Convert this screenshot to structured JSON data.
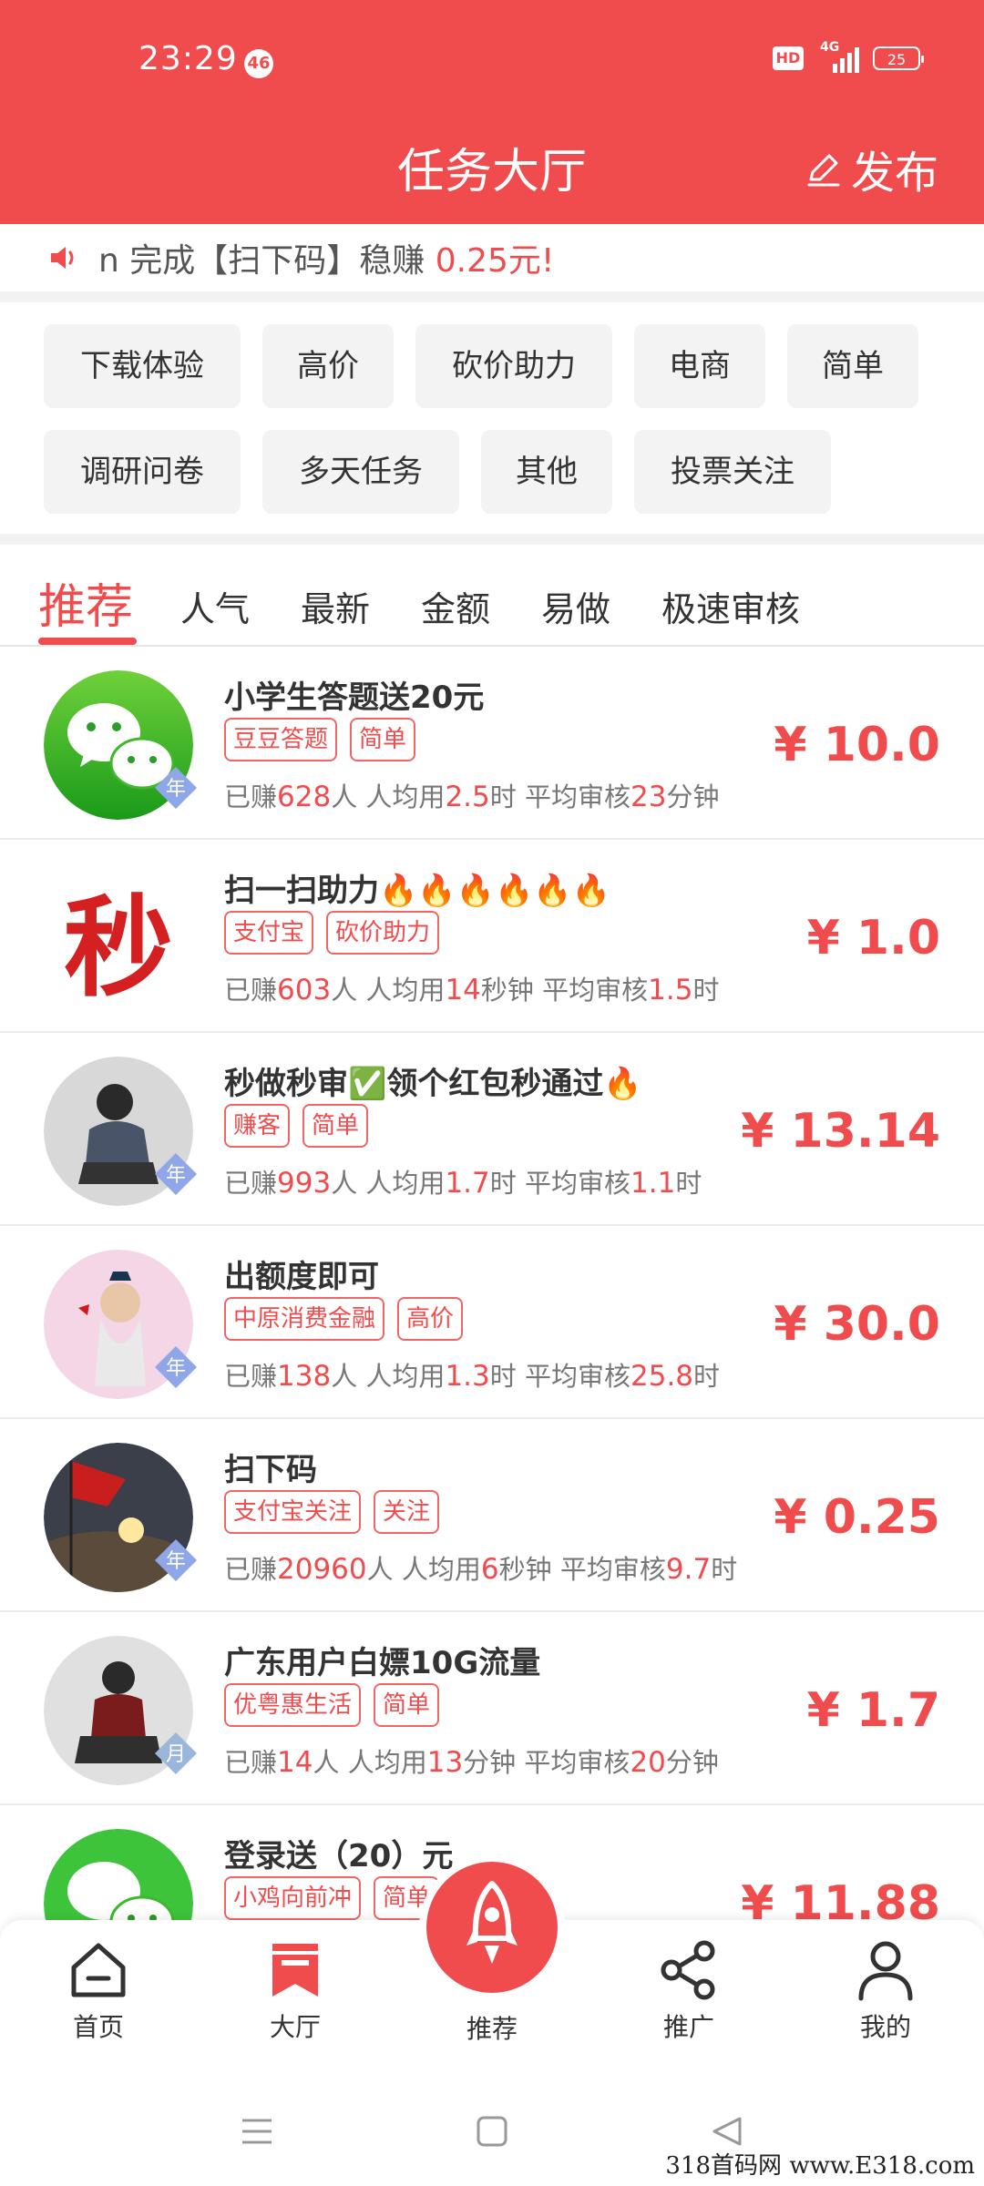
{
  "status_bar": {
    "time": "23:29",
    "notif_count": "46",
    "hd": "HD",
    "network": "4G",
    "battery": "25"
  },
  "header": {
    "title": "任务大厅",
    "publish_label": "发布"
  },
  "notice": {
    "prefix": "n 完成【扫下码】稳赚 ",
    "amount": "0.25元!"
  },
  "categories": [
    "下载体验",
    "高价",
    "砍价助力",
    "电商",
    "简单",
    "调研问卷",
    "多天任务",
    "其他",
    "投票关注"
  ],
  "sort_tabs": [
    "推荐",
    "人气",
    "最新",
    "金额",
    "易做",
    "极速审核"
  ],
  "tasks": [
    {
      "title": "小学生答题送20元",
      "tags": [
        "豆豆答题",
        "简单"
      ],
      "earned_label": "已赚",
      "earned": "628",
      "earned_unit": "人",
      "avg_label": "人均用",
      "avg": "2.5",
      "avg_unit": "时",
      "review_label": "平均审核",
      "review": "23",
      "review_unit": "分钟",
      "price": "¥ 10.0",
      "period": "年"
    },
    {
      "title": "扫一扫助力🔥🔥🔥🔥🔥🔥",
      "tags": [
        "支付宝",
        "砍价助力"
      ],
      "earned_label": "已赚",
      "earned": "603",
      "earned_unit": "人",
      "avg_label": "人均用",
      "avg": "14",
      "avg_unit": "秒钟",
      "review_label": "平均审核",
      "review": "1.5",
      "review_unit": "时",
      "price": "¥ 1.0",
      "avatar_text": "秒"
    },
    {
      "title": "秒做秒审✅领个红包秒通过🔥",
      "tags": [
        "赚客",
        "简单"
      ],
      "earned_label": "已赚",
      "earned": "993",
      "earned_unit": "人",
      "avg_label": "人均用",
      "avg": "1.7",
      "avg_unit": "时",
      "review_label": "平均审核",
      "review": "1.1",
      "review_unit": "时",
      "price": "¥ 13.14",
      "period": "年"
    },
    {
      "title": "出额度即可",
      "tags": [
        "中原消费金融",
        "高价"
      ],
      "earned_label": "已赚",
      "earned": "138",
      "earned_unit": "人",
      "avg_label": "人均用",
      "avg": "1.3",
      "avg_unit": "时",
      "review_label": "平均审核",
      "review": "25.8",
      "review_unit": "时",
      "price": "¥ 30.0",
      "period": "年"
    },
    {
      "title": "扫下码",
      "tags": [
        "支付宝关注",
        "关注"
      ],
      "earned_label": "已赚",
      "earned": "20960",
      "earned_unit": "人",
      "avg_label": "人均用",
      "avg": "6",
      "avg_unit": "秒钟",
      "review_label": "平均审核",
      "review": "9.7",
      "review_unit": "时",
      "price": "¥ 0.25",
      "period": "年"
    },
    {
      "title": "广东用户白嫖10G流量",
      "tags": [
        "优粤惠生活",
        "简单"
      ],
      "earned_label": "已赚",
      "earned": "14",
      "earned_unit": "人",
      "avg_label": "人均用",
      "avg": "13",
      "avg_unit": "分钟",
      "review_label": "平均审核",
      "review": "20",
      "review_unit": "分钟",
      "price": "¥ 1.7",
      "period": "月"
    },
    {
      "title": "登录送（20）元",
      "tags": [
        "小鸡向前冲",
        "简单"
      ],
      "price": "¥ 11.88"
    }
  ],
  "bottom_nav": [
    "首页",
    "大厅",
    "推荐",
    "推广",
    "我的"
  ],
  "watermark": "318首码网 www.E318.com",
  "colors": {
    "brand": "#f04b4d",
    "chip_bg": "#f3f3f3",
    "text": "#333333"
  }
}
